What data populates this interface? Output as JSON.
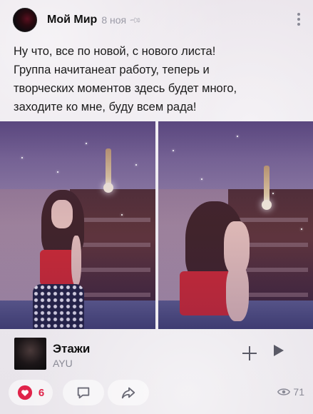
{
  "post": {
    "author": "Мой Мир",
    "date": "8 ноя",
    "text_lines": [
      "Ну что, все по новой, с нового листа!",
      "Группа начитанеат работу, теперь и",
      "творческих моментов здесь будет много,",
      "заходите ко мне, буду всем рада!"
    ]
  },
  "track": {
    "title": "Этажи",
    "artist": "AYU"
  },
  "actions": {
    "likes": "6",
    "views": "71"
  },
  "colors": {
    "like": "#e0244a",
    "icon": "#5a5a66",
    "muted": "#8a8a96"
  },
  "icons": [
    "avatar",
    "pin-icon",
    "more-icon",
    "plus-icon",
    "play-icon",
    "heart-icon",
    "comment-icon",
    "share-icon",
    "eye-icon"
  ]
}
